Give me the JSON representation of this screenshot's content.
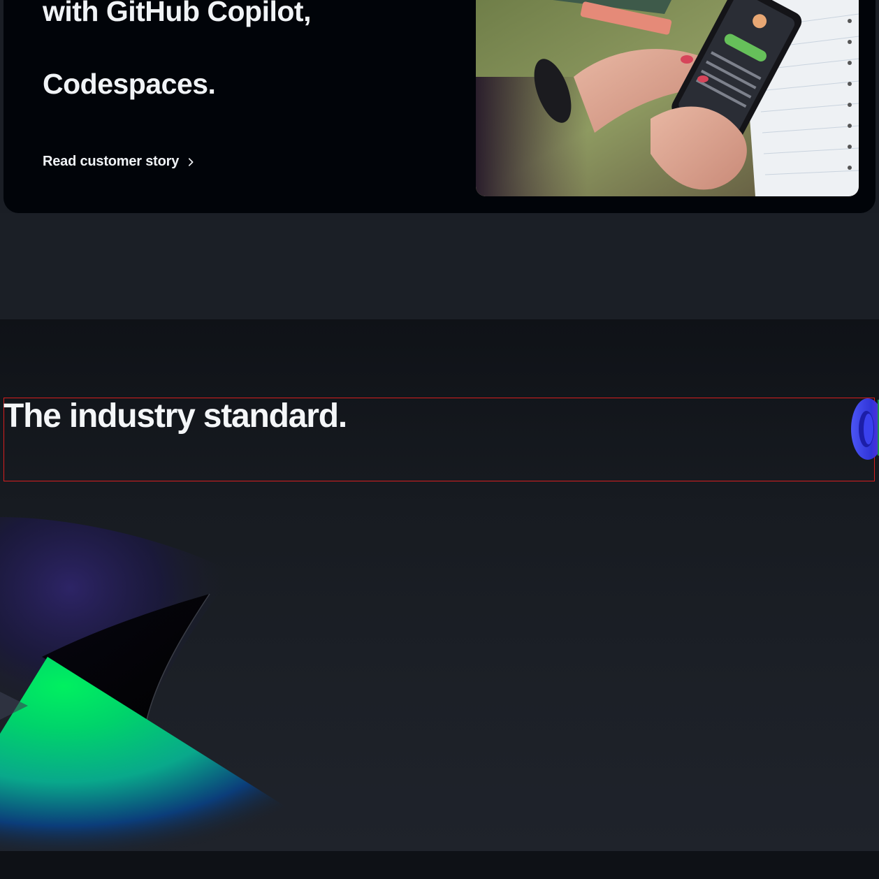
{
  "story": {
    "heading_line1": "with GitHub Copilot,",
    "heading_line2": "Codespaces.",
    "link_label": "Read customer story",
    "photo_alt": "Person typing on a smartphone over a notebook"
  },
  "section": {
    "title": "The industry standard."
  },
  "colors": {
    "card_bg": "#010409",
    "page_bg": "#1a1e25",
    "text": "#f0f3f6",
    "accent_green": "#00e05a",
    "accent_blue": "#3b3fe0",
    "outline_red": "#d61f1f"
  }
}
